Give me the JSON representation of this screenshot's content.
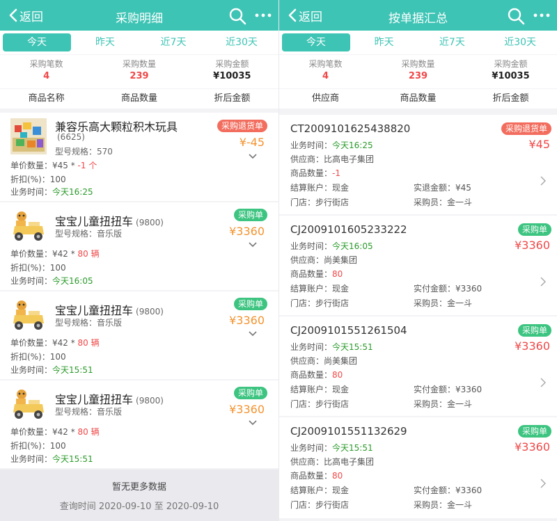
{
  "left": {
    "back_label": "返回",
    "title": "采购明细",
    "tabs": [
      "今天",
      "昨天",
      "近7天",
      "近30天"
    ],
    "stats": [
      {
        "label": "采购笔数",
        "value": "4"
      },
      {
        "label": "采购数量",
        "value": "239"
      },
      {
        "label": "采购金额",
        "value": "¥10035"
      }
    ],
    "columns": [
      "商品名称",
      "商品数量",
      "折后金额"
    ],
    "items": [
      {
        "name": "兼容乐高大颗粒积木玩具",
        "code": "(6625)",
        "spec": "型号规格：570",
        "badge": "采购退货单",
        "amount": "¥-45",
        "unit_prefix": "单价数量：¥45 * ",
        "unit_qty": "-1 个",
        "discount": "折扣(%)：100",
        "time_label": "业务时间：",
        "time": "今天16:25"
      },
      {
        "name": "宝宝儿童扭扭车",
        "code": "(9800)",
        "spec": "型号规格：音乐版",
        "badge": "采购单",
        "amount": "¥3360",
        "unit_prefix": "单价数量：¥42 * ",
        "unit_qty": "80 辆",
        "discount": "折扣(%)：100",
        "time_label": "业务时间：",
        "time": "今天16:05"
      },
      {
        "name": "宝宝儿童扭扭车",
        "code": "(9800)",
        "spec": "型号规格：音乐版",
        "badge": "采购单",
        "amount": "¥3360",
        "unit_prefix": "单价数量：¥42 * ",
        "unit_qty": "80 辆",
        "discount": "折扣(%)：100",
        "time_label": "业务时间：",
        "time": "今天15:51"
      },
      {
        "name": "宝宝儿童扭扭车",
        "code": "(9800)",
        "spec": "型号规格：音乐版",
        "badge": "采购单",
        "amount": "¥3360",
        "unit_prefix": "单价数量：¥42 * ",
        "unit_qty": "80 辆",
        "discount": "折扣(%)：100",
        "time_label": "业务时间：",
        "time": "今天15:51"
      }
    ],
    "footer": {
      "no_more": "暂无更多数据",
      "query": "查询时间 2020-09-10 至 2020-09-10"
    }
  },
  "right": {
    "back_label": "返回",
    "title": "按单据汇总",
    "tabs": [
      "今天",
      "昨天",
      "近7天",
      "近30天"
    ],
    "stats": [
      {
        "label": "采购笔数",
        "value": "4"
      },
      {
        "label": "采购数量",
        "value": "239"
      },
      {
        "label": "采购金额",
        "value": "¥10035"
      }
    ],
    "columns": [
      "供应商",
      "商品数量",
      "折后金额"
    ],
    "cards": [
      {
        "no": "CT2009101625438820",
        "badge": "采购退货单",
        "amount": "¥45",
        "time_label": "业务时间：",
        "time": "今天16:25",
        "supplier": "供应商：比高电子集团",
        "qty_label": "商品数量：",
        "qty": "-1",
        "account": "结算账户：现金",
        "money": "实退金额：¥45",
        "store": "门店：步行街店",
        "buyer": "采购员：金一斗"
      },
      {
        "no": "CJ2009101605233222",
        "badge": "采购单",
        "amount": "¥3360",
        "time_label": "业务时间：",
        "time": "今天16:05",
        "supplier": "供应商：尚美集团",
        "qty_label": "商品数量：",
        "qty": "80",
        "account": "结算账户：现金",
        "money": "实付金额：¥3360",
        "store": "门店：步行街店",
        "buyer": "采购员：金一斗"
      },
      {
        "no": "CJ2009101551261504",
        "badge": "采购单",
        "amount": "¥3360",
        "time_label": "业务时间：",
        "time": "今天15:51",
        "supplier": "供应商：尚美集团",
        "qty_label": "商品数量：",
        "qty": "80",
        "account": "结算账户：现金",
        "money": "实付金额：¥3360",
        "store": "门店：步行街店",
        "buyer": "采购员：金一斗"
      },
      {
        "no": "CJ2009101551132629",
        "badge": "采购单",
        "amount": "¥3360",
        "time_label": "业务时间：",
        "time": "今天15:51",
        "supplier": "供应商：比高电子集团",
        "qty_label": "商品数量：",
        "qty": "80",
        "account": "结算账户：现金",
        "money": "实付金额：¥3360",
        "store": "门店：步行街店",
        "buyer": "采购员：金一斗"
      }
    ]
  },
  "colors": {
    "accent": "#3ec4b5",
    "red": "#f04848",
    "orange": "#f3932f",
    "green": "#2a9a2a",
    "badge_return": "#f26d5e",
    "badge_purchase": "#3cc480"
  },
  "icons": {
    "back": "chevron-left-icon",
    "search": "search-icon",
    "more": "more-dots-icon",
    "expand": "chevron-down-icon",
    "detail": "chevron-right-icon"
  }
}
